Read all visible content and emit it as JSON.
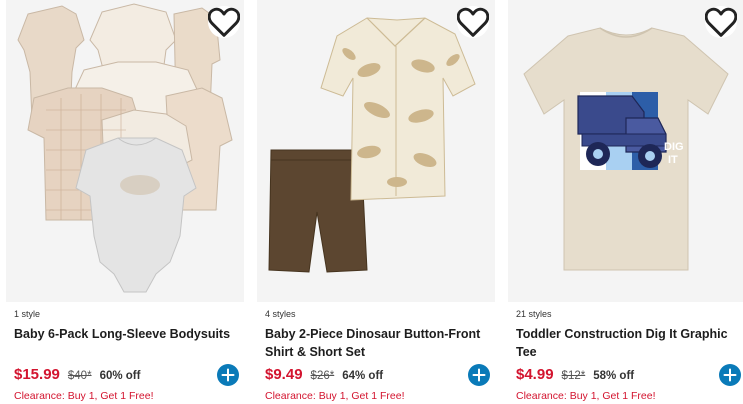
{
  "colors": {
    "price_red": "#d3142f",
    "add_button": "#0a7ab8",
    "image_bg": "#f4f4f4"
  },
  "products": [
    {
      "styles": "1 style",
      "name": "Baby 6-Pack Long-Sleeve Bodysuits",
      "price": "$15.99",
      "original_price": "$40*",
      "discount": "60% off",
      "promo": "Clearance: Buy 1, Get 1 Free!",
      "image_icon": "bodysuits-image",
      "favorite_icon": "heart-icon",
      "add_icon": "plus-icon"
    },
    {
      "styles": "4 styles",
      "name": "Baby 2-Piece Dinosaur Button-Front Shirt & Short Set",
      "price": "$9.49",
      "original_price": "$26*",
      "discount": "64% off",
      "promo": "Clearance: Buy 1, Get 1 Free!",
      "image_icon": "shirt-short-set-image",
      "favorite_icon": "heart-icon",
      "add_icon": "plus-icon"
    },
    {
      "styles": "21 styles",
      "name": "Toddler Construction Dig It Graphic Tee",
      "price": "$4.99",
      "original_price": "$12*",
      "discount": "58% off",
      "promo": "Clearance: Buy 1, Get 1 Free!",
      "image_icon": "graphic-tee-image",
      "graphic_text": [
        "DIG",
        "IT"
      ],
      "favorite_icon": "heart-icon",
      "add_icon": "plus-icon"
    }
  ]
}
